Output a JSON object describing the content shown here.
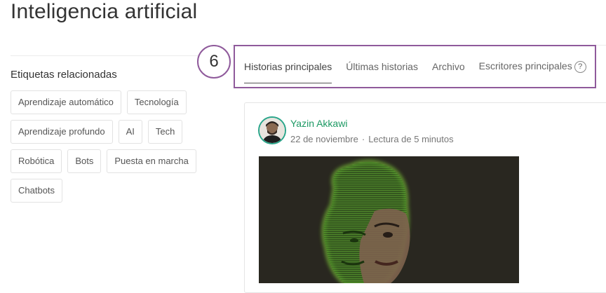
{
  "page": {
    "title": "Inteligencia artificial"
  },
  "tags": {
    "heading": "Etiquetas relacionadas",
    "rows": [
      [
        "Aprendizaje automático",
        "Tecnología"
      ],
      [
        "Aprendizaje profundo",
        "AI",
        "Tech"
      ],
      [
        "Robótica",
        "Bots",
        "Puesta en marcha"
      ],
      [
        "Chatbots"
      ]
    ]
  },
  "step": {
    "number": "6"
  },
  "tabs": [
    {
      "label": "Historias principales",
      "active": true
    },
    {
      "label": "Últimas historias",
      "active": false
    },
    {
      "label": "Archivo",
      "active": false
    },
    {
      "label": "Escritores principales",
      "active": false
    }
  ],
  "help": {
    "icon": "question-circle-icon",
    "glyph": "?"
  },
  "story": {
    "author": "Yazin Akkawi",
    "date": "22 de noviembre",
    "separator": "·",
    "read_time": "Lectura de 5 minutos"
  },
  "colors": {
    "highlight": "#8f5a9b",
    "author_link": "#1c9963",
    "avatar_ring": "#2aa58a",
    "image_glow": "#7ec83a"
  }
}
